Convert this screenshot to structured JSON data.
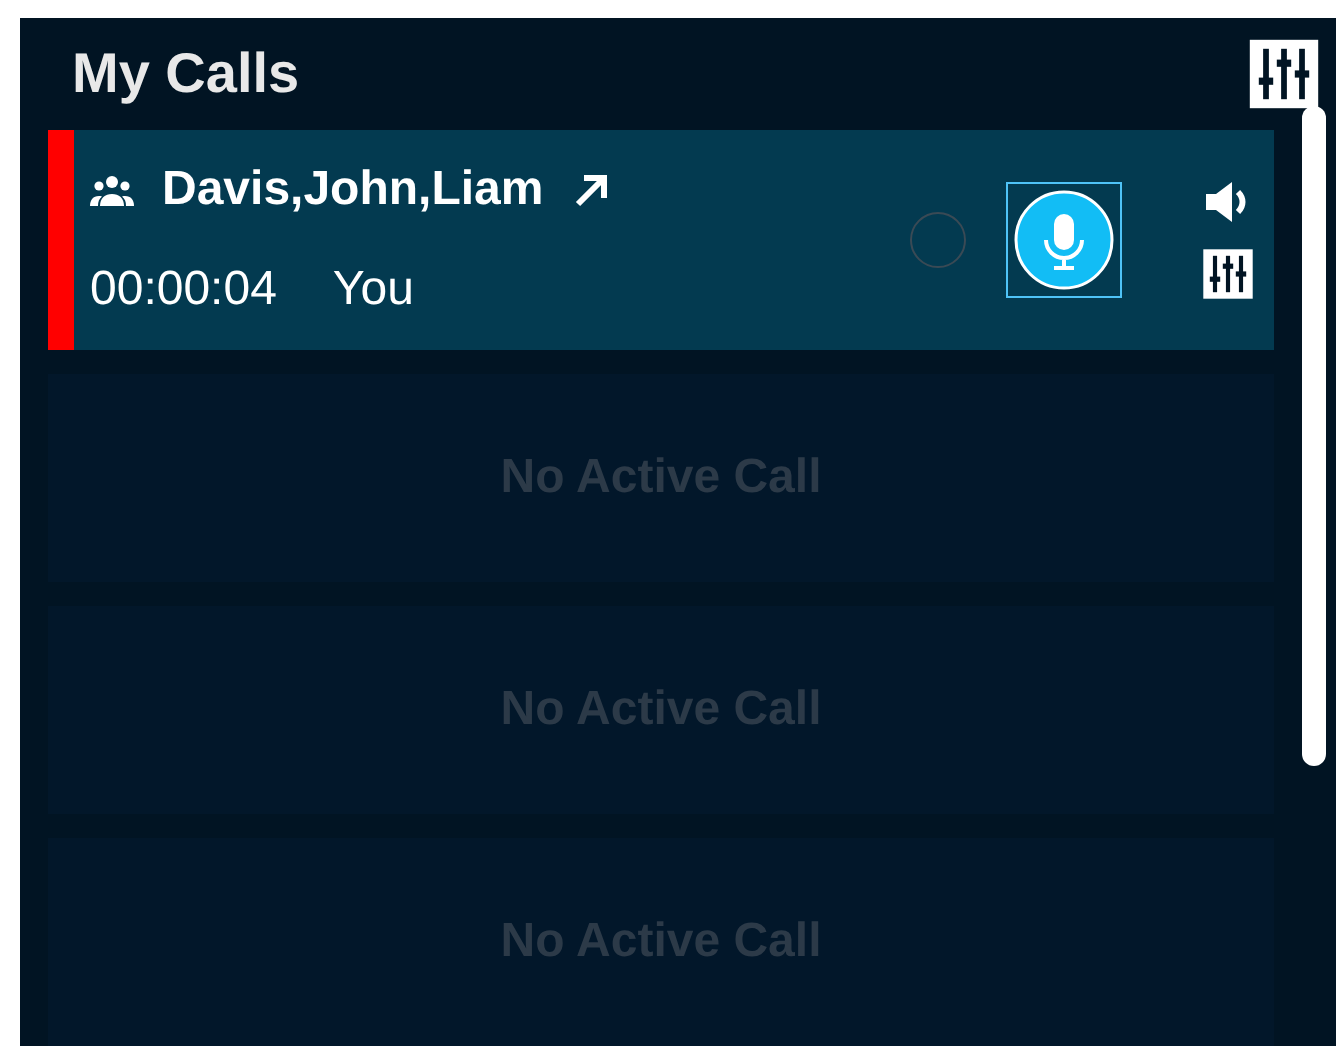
{
  "header": {
    "title": "My Calls"
  },
  "calls": [
    {
      "kind": "active",
      "name": "Davis,John,Liam",
      "duration": "00:00:04",
      "speaker": "You",
      "mic_on": true
    },
    {
      "kind": "empty",
      "label": "No Active Call"
    },
    {
      "kind": "empty",
      "label": "No Active Call"
    },
    {
      "kind": "empty",
      "label": "No Active Call"
    }
  ]
}
